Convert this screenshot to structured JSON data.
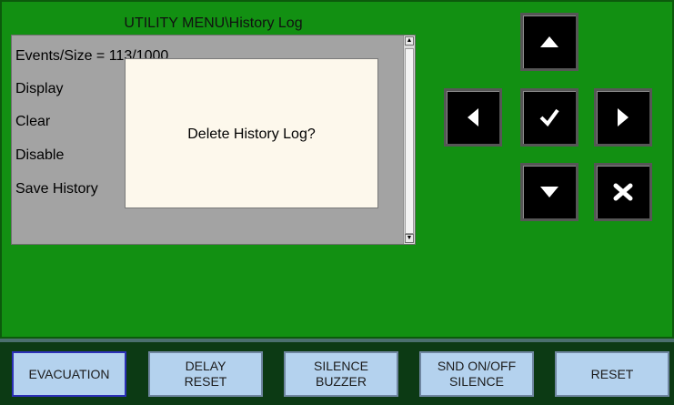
{
  "menu": {
    "title": "UTILITY MENU\\History Log",
    "items": [
      {
        "label": "Events/Size = 113/1000"
      },
      {
        "label": "Display"
      },
      {
        "label": "Clear"
      },
      {
        "label": "Disable"
      },
      {
        "label": "Save History"
      }
    ]
  },
  "dialog": {
    "message": "Delete History Log?"
  },
  "nav_pad": {
    "up": "arrow-up-icon",
    "left": "arrow-left-icon",
    "ok": "check-icon",
    "right": "arrow-right-icon",
    "down": "arrow-down-icon",
    "cancel": "x-icon"
  },
  "function_keys": [
    {
      "label": "EVACUATION"
    },
    {
      "label": "DELAY\nRESET"
    },
    {
      "label": "SILENCE\nBUZZER"
    },
    {
      "label": "SND ON/OFF\nSILENCE"
    },
    {
      "label": "RESET"
    }
  ],
  "colors": {
    "background": "#129012",
    "button_face": "#000000",
    "function_key": "#b4d2ee",
    "dialog": "#fdf8ec"
  }
}
